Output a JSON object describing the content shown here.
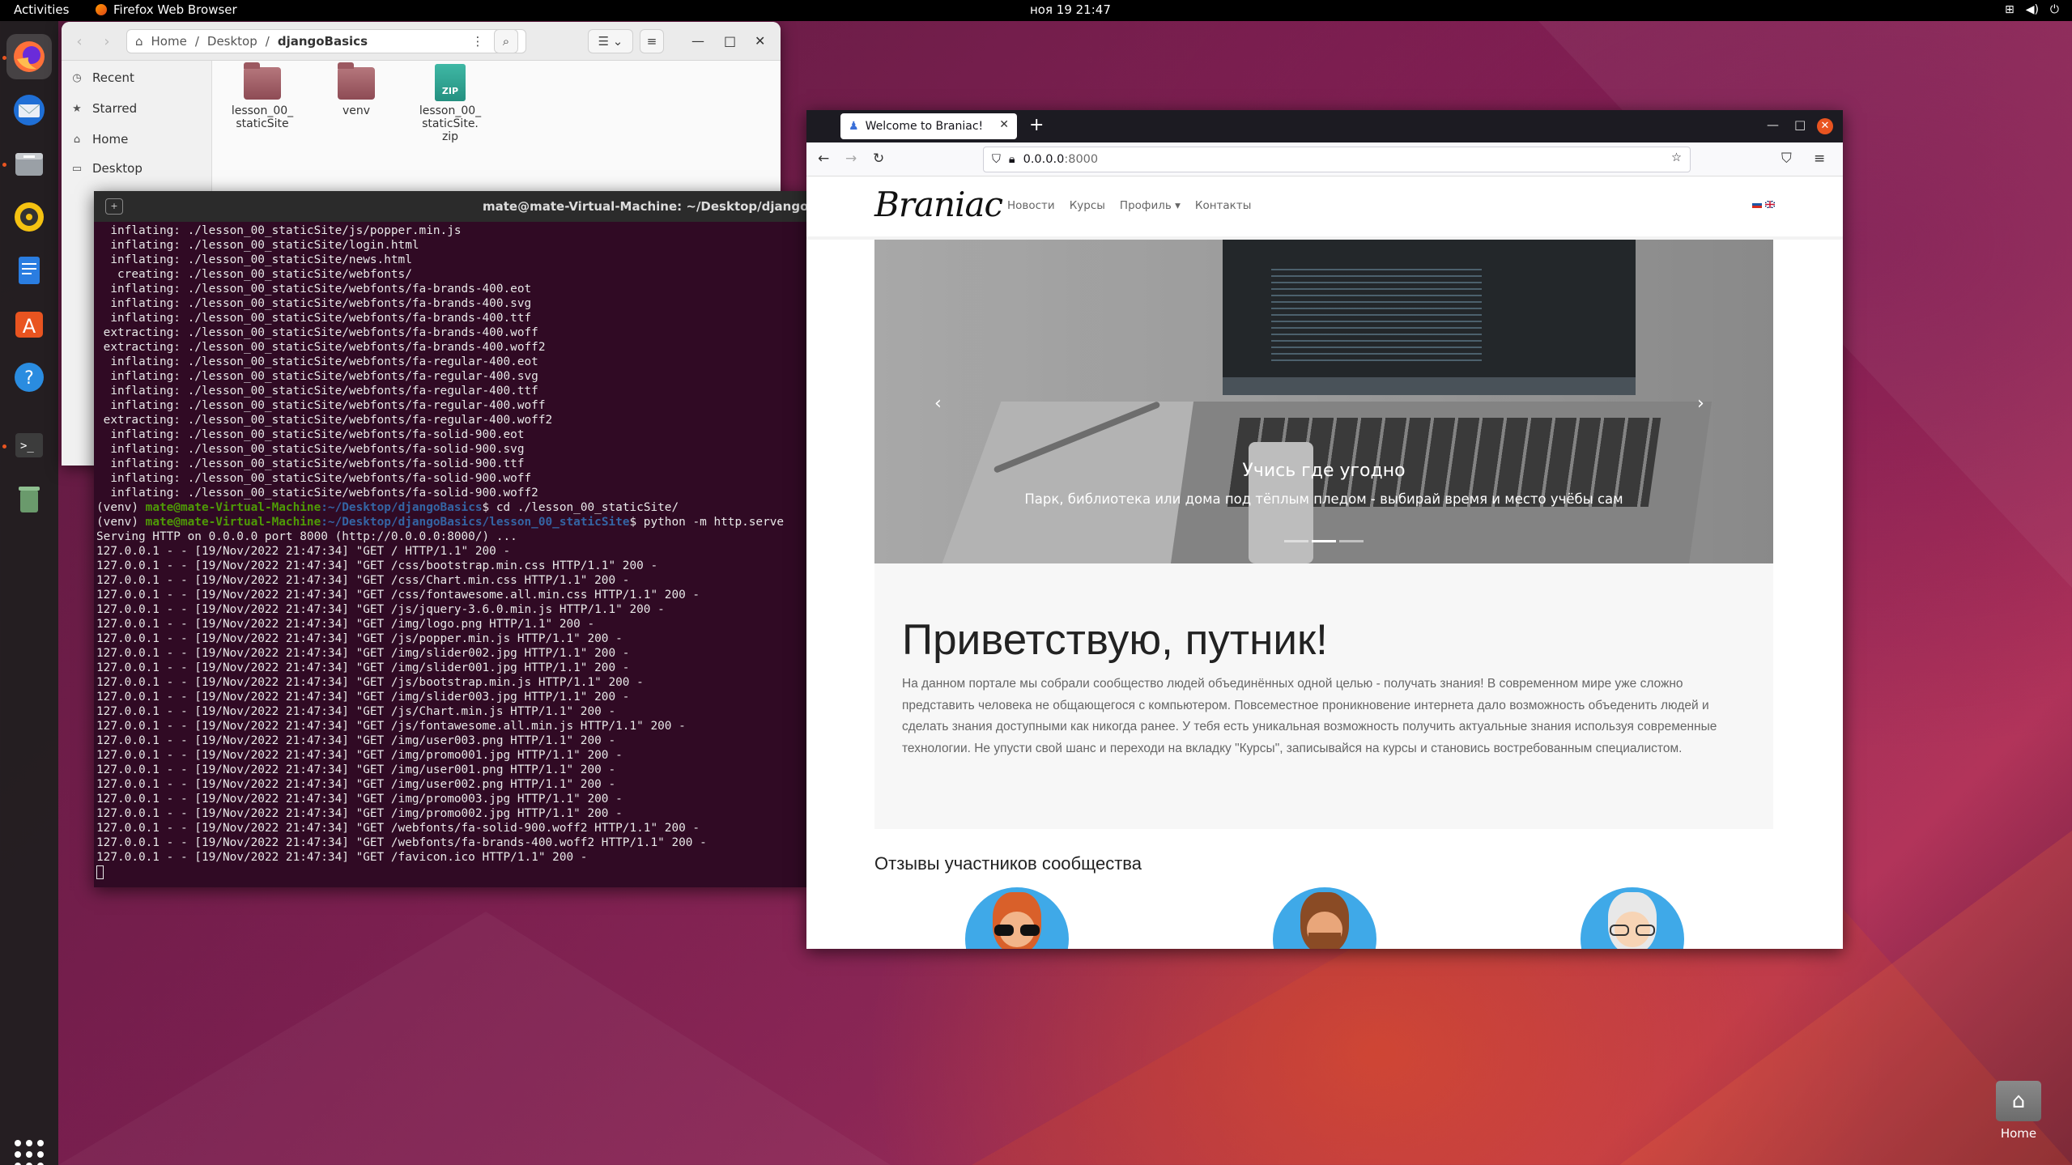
{
  "topbar": {
    "activities": "Activities",
    "app_name": "Firefox Web Browser",
    "clock": "ноя 19  21:47",
    "tray_icons": [
      "network-icon",
      "volume-icon",
      "power-icon"
    ]
  },
  "dock": {
    "apps": [
      "firefox-icon",
      "thunderbird-icon",
      "files-icon",
      "rhythmbox-icon",
      "writer-icon",
      "software-icon",
      "help-icon",
      "terminal-icon",
      "trash-icon"
    ]
  },
  "files": {
    "breadcrumb": {
      "home": "Home",
      "sep1": "/",
      "desktop": "Desktop",
      "sep2": "/",
      "current": "djangoBasics"
    },
    "sidebar": [
      {
        "label": "Recent",
        "icon": "clock-icon"
      },
      {
        "label": "Starred",
        "icon": "star-icon"
      },
      {
        "label": "Home",
        "icon": "home-icon"
      },
      {
        "label": "Desktop",
        "icon": "desktop-icon"
      }
    ],
    "items": [
      {
        "name": "lesson_00_\nstaticSite",
        "kind": "folder"
      },
      {
        "name": "venv",
        "kind": "folder"
      },
      {
        "name": "lesson_00_\nstaticSite.\nzip",
        "kind": "zip",
        "badge": "ZIP"
      }
    ]
  },
  "terminal": {
    "title": "mate@mate-Virtual-Machine: ~/Desktop/djangoBasics/le",
    "lines_before": [
      "  inflating: ./lesson_00_staticSite/js/popper.min.js",
      "  inflating: ./lesson_00_staticSite/login.html",
      "  inflating: ./lesson_00_staticSite/news.html",
      "   creating: ./lesson_00_staticSite/webfonts/",
      "  inflating: ./lesson_00_staticSite/webfonts/fa-brands-400.eot",
      "  inflating: ./lesson_00_staticSite/webfonts/fa-brands-400.svg",
      "  inflating: ./lesson_00_staticSite/webfonts/fa-brands-400.ttf",
      " extracting: ./lesson_00_staticSite/webfonts/fa-brands-400.woff",
      " extracting: ./lesson_00_staticSite/webfonts/fa-brands-400.woff2",
      "  inflating: ./lesson_00_staticSite/webfonts/fa-regular-400.eot",
      "  inflating: ./lesson_00_staticSite/webfonts/fa-regular-400.svg",
      "  inflating: ./lesson_00_staticSite/webfonts/fa-regular-400.ttf",
      "  inflating: ./lesson_00_staticSite/webfonts/fa-regular-400.woff",
      " extracting: ./lesson_00_staticSite/webfonts/fa-regular-400.woff2",
      "  inflating: ./lesson_00_staticSite/webfonts/fa-solid-900.eot",
      "  inflating: ./lesson_00_staticSite/webfonts/fa-solid-900.svg",
      "  inflating: ./lesson_00_staticSite/webfonts/fa-solid-900.ttf",
      "  inflating: ./lesson_00_staticSite/webfonts/fa-solid-900.woff",
      "  inflating: ./lesson_00_staticSite/webfonts/fa-solid-900.woff2"
    ],
    "prompt1": {
      "venv": "(venv) ",
      "user": "mate@mate-Virtual-Machine",
      "path": ":~/Desktop/djangoBasics",
      "cmd": "$ cd ./lesson_00_staticSite/"
    },
    "prompt2": {
      "venv": "(venv) ",
      "user": "mate@mate-Virtual-Machine",
      "path": ":~/Desktop/djangoBasics/lesson_00_staticSite",
      "cmd": "$ python -m http.serve"
    },
    "lines_after": [
      "Serving HTTP on 0.0.0.0 port 8000 (http://0.0.0.0:8000/) ...",
      "127.0.0.1 - - [19/Nov/2022 21:47:34] \"GET / HTTP/1.1\" 200 -",
      "127.0.0.1 - - [19/Nov/2022 21:47:34] \"GET /css/bootstrap.min.css HTTP/1.1\" 200 -",
      "127.0.0.1 - - [19/Nov/2022 21:47:34] \"GET /css/Chart.min.css HTTP/1.1\" 200 -",
      "127.0.0.1 - - [19/Nov/2022 21:47:34] \"GET /css/fontawesome.all.min.css HTTP/1.1\" 200 -",
      "127.0.0.1 - - [19/Nov/2022 21:47:34] \"GET /js/jquery-3.6.0.min.js HTTP/1.1\" 200 -",
      "127.0.0.1 - - [19/Nov/2022 21:47:34] \"GET /img/logo.png HTTP/1.1\" 200 -",
      "127.0.0.1 - - [19/Nov/2022 21:47:34] \"GET /js/popper.min.js HTTP/1.1\" 200 -",
      "127.0.0.1 - - [19/Nov/2022 21:47:34] \"GET /img/slider002.jpg HTTP/1.1\" 200 -",
      "127.0.0.1 - - [19/Nov/2022 21:47:34] \"GET /img/slider001.jpg HTTP/1.1\" 200 -",
      "127.0.0.1 - - [19/Nov/2022 21:47:34] \"GET /js/bootstrap.min.js HTTP/1.1\" 200 -",
      "127.0.0.1 - - [19/Nov/2022 21:47:34] \"GET /img/slider003.jpg HTTP/1.1\" 200 -",
      "127.0.0.1 - - [19/Nov/2022 21:47:34] \"GET /js/Chart.min.js HTTP/1.1\" 200 -",
      "127.0.0.1 - - [19/Nov/2022 21:47:34] \"GET /js/fontawesome.all.min.js HTTP/1.1\" 200 -",
      "127.0.0.1 - - [19/Nov/2022 21:47:34] \"GET /img/user003.png HTTP/1.1\" 200 -",
      "127.0.0.1 - - [19/Nov/2022 21:47:34] \"GET /img/promo001.jpg HTTP/1.1\" 200 -",
      "127.0.0.1 - - [19/Nov/2022 21:47:34] \"GET /img/user001.png HTTP/1.1\" 200 -",
      "127.0.0.1 - - [19/Nov/2022 21:47:34] \"GET /img/user002.png HTTP/1.1\" 200 -",
      "127.0.0.1 - - [19/Nov/2022 21:47:34] \"GET /img/promo003.jpg HTTP/1.1\" 200 -",
      "127.0.0.1 - - [19/Nov/2022 21:47:34] \"GET /img/promo002.jpg HTTP/1.1\" 200 -",
      "127.0.0.1 - - [19/Nov/2022 21:47:34] \"GET /webfonts/fa-solid-900.woff2 HTTP/1.1\" 200 -",
      "127.0.0.1 - - [19/Nov/2022 21:47:34] \"GET /webfonts/fa-brands-400.woff2 HTTP/1.1\" 200 -",
      "127.0.0.1 - - [19/Nov/2022 21:47:34] \"GET /favicon.ico HTTP/1.1\" 200 -"
    ]
  },
  "firefox": {
    "tab_title": "Welcome to Braniac!",
    "url_host": "0.0.0.0",
    "url_port": ":8000",
    "site": {
      "logo": "Braniac",
      "menu": [
        "Новости",
        "Курсы",
        "Профиль ▾",
        "Контакты"
      ],
      "slide_title": "Учись где угодно",
      "slide_text": "Парк, библиотека или дома под тёплым пледом - выбирай время и место учёбы сам",
      "slide_count": 3,
      "slide_active": 2,
      "heading": "Приветствую, путник!",
      "intro": "На данном портале мы собрали сообщество людей объединённых одной целью - получать знания! В современном мире уже сложно представить человека не общающегося с компьютером. Повсеместное проникновение интернета дало возможность объеденить людей и сделать знания доступными как никогда ранее. У тебя есть уникальная возможность получить актуальные знания используя современные технологии. Не упусти свой шанс и переходи на вкладку \"Курсы\", записывайся на курсы и становись востребованным специалистом.",
      "reviews_title": "Отзывы участников сообщества"
    }
  },
  "desktop": {
    "home_label": "Home"
  },
  "colors": {
    "ubuntu_orange": "#e95420",
    "terminal_bg": "#300a24",
    "prompt_user": "#4e9a06",
    "prompt_path": "#3465a4"
  }
}
